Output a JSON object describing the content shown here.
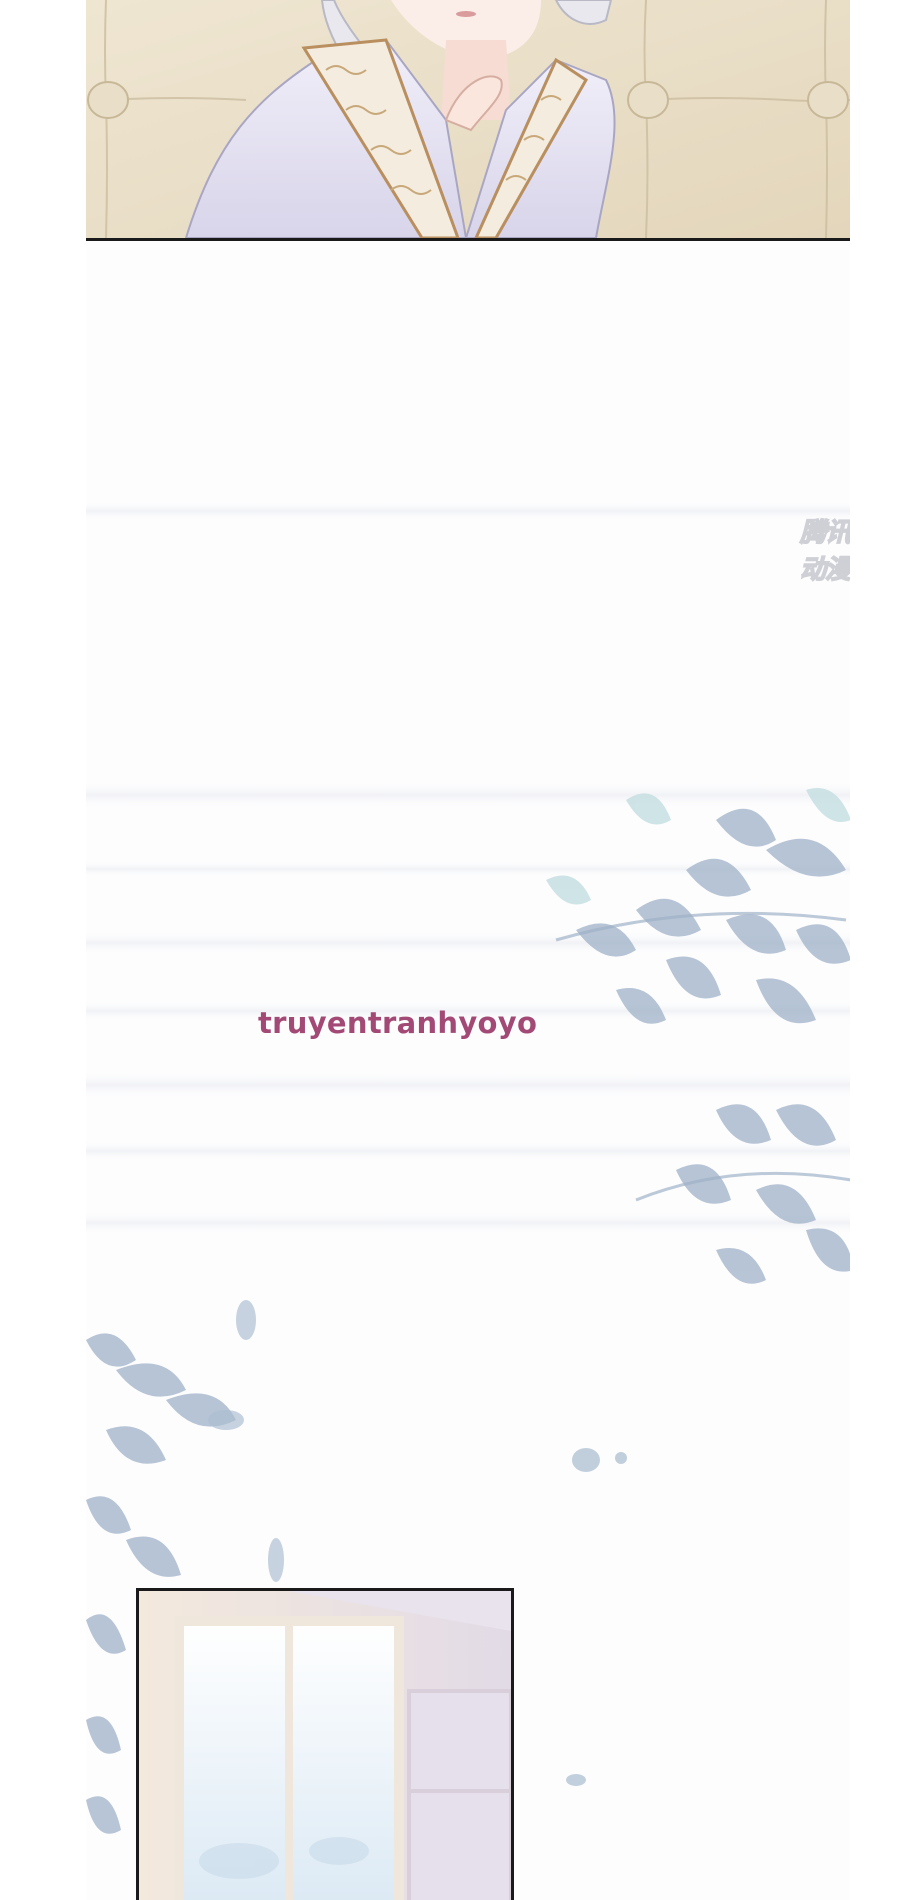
{
  "credit": {
    "text": "truyentranhyoyo",
    "color": "#a24a75"
  },
  "watermark": {
    "text": "腾讯动漫"
  },
  "panels": {
    "top": {
      "subject": "character-in-white-robe",
      "background": "#e8dcc4",
      "robe_color": "#e4e1f1",
      "trim_color": "#c8a878"
    },
    "window": {
      "subject": "sunlit-window",
      "frame_color": "#efe7dc"
    }
  },
  "decor": {
    "leaf_color": "#8fa4bd",
    "leaf_color_light": "#b9d6dc"
  }
}
